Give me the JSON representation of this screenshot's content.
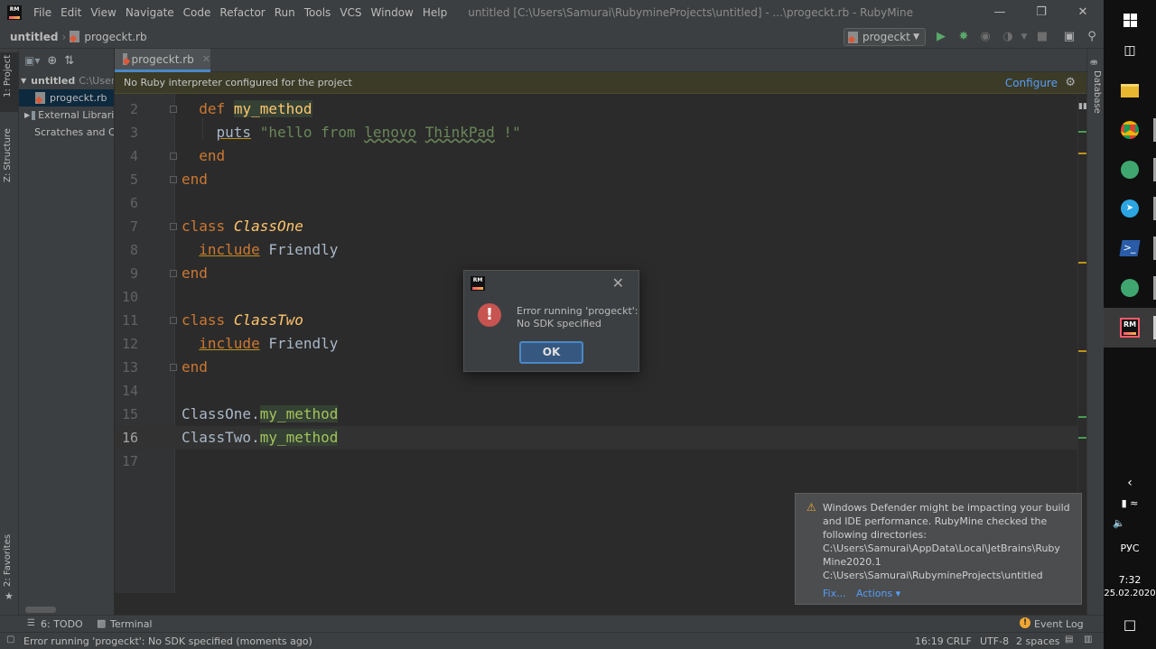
{
  "window": {
    "title": "untitled [C:\\Users\\Samurai\\RubymineProjects\\untitled] - ...\\progeckt.rb - RubyMine",
    "logo_text": "RM",
    "menu": [
      "File",
      "Edit",
      "View",
      "Navigate",
      "Code",
      "Refactor",
      "Run",
      "Tools",
      "VCS",
      "Window",
      "Help"
    ]
  },
  "breadcrumbs": {
    "project": "untitled",
    "file": "progeckt.rb"
  },
  "run_config": {
    "label": "progeckt"
  },
  "left_stripe": {
    "project_tab": "1: Project",
    "structure_tab": "Z: Structure",
    "favorites_tab": "2: Favorites"
  },
  "right_stripe": {
    "database_tab": "Database"
  },
  "project_tree": {
    "root_name": "untitled",
    "root_path": "C:\\Users",
    "file": "progeckt.rb",
    "external_libraries": "External Libraries",
    "scratches": "Scratches and Co"
  },
  "editor": {
    "tab_label": "progeckt.rb",
    "banner_text": "No Ruby interpreter configured for the project",
    "banner_link": "Configure",
    "current_line": 16,
    "line_numbers": [
      "2",
      "3",
      "4",
      "5",
      "6",
      "7",
      "8",
      "9",
      "10",
      "11",
      "12",
      "13",
      "14",
      "15",
      "16",
      "17"
    ]
  },
  "dialog": {
    "message": "Error running 'progeckt':\nNo SDK specified",
    "ok_label": "OK"
  },
  "notification": {
    "text": "Windows Defender might be impacting your build and IDE performance. RubyMine checked the following directories:",
    "path1": "C:\\Users\\Samurai\\AppData\\Local\\JetBrains\\Ruby Mine2020.1",
    "path2": "C:\\Users\\Samurai\\RubymineProjects\\untitled",
    "fix_label": "Fix...",
    "actions_label": "Actions ▾"
  },
  "tool_windows": {
    "todo": "6: TODO",
    "terminal": "Terminal",
    "event_log": "Event Log"
  },
  "status_bar": {
    "message": "Error running 'progeckt': No SDK specified (moments ago)",
    "position": "16:19",
    "line_separator": "CRLF",
    "encoding": "UTF-8",
    "indent": "2 spaces"
  },
  "taskbar": {
    "language": "РУС",
    "time": "7:32",
    "date": "25.02.2020",
    "apps": [
      "explorer-icon",
      "chrome-icon",
      "atom-icon",
      "telegram-icon",
      "powershell-icon",
      "atom-icon",
      "rubymine-icon"
    ]
  },
  "colors": {
    "keyword": "#cc7832",
    "method": "#ffc66d",
    "string": "#6a8759",
    "error": "#c75450",
    "warning": "#f0a732",
    "link": "#589df6",
    "banner_bg": "#3b3b28"
  }
}
